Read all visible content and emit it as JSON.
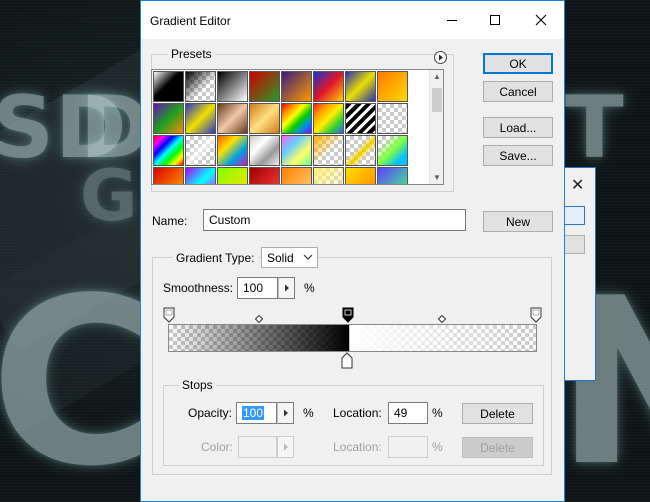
{
  "dialog": {
    "title": "Gradient Editor",
    "presets_label": "Presets",
    "name_label": "Name:",
    "name_value": "Custom",
    "buttons": {
      "ok": "OK",
      "cancel": "Cancel",
      "load": "Load...",
      "save": "Save...",
      "new": "New"
    },
    "gradient_type_label": "Gradient Type:",
    "gradient_type_value": "Solid",
    "smoothness_label": "Smoothness:",
    "smoothness_value": "100",
    "smoothness_unit": "%",
    "stops": {
      "label": "Stops",
      "opacity_label": "Opacity:",
      "opacity_value": "100",
      "opacity_unit": "%",
      "opacity_location_label": "Location:",
      "opacity_location_value": "49",
      "opacity_location_unit": "%",
      "delete_label": "Delete",
      "color_label": "Color:",
      "color_location_label": "Location:",
      "color_location_unit": "%"
    }
  },
  "colors": {
    "accent": "#0078d7",
    "selection": "#3399ff"
  },
  "background": {
    "letters": [
      "S",
      "D",
      "D",
      "T",
      "C",
      "N",
      "C",
      "G"
    ]
  }
}
